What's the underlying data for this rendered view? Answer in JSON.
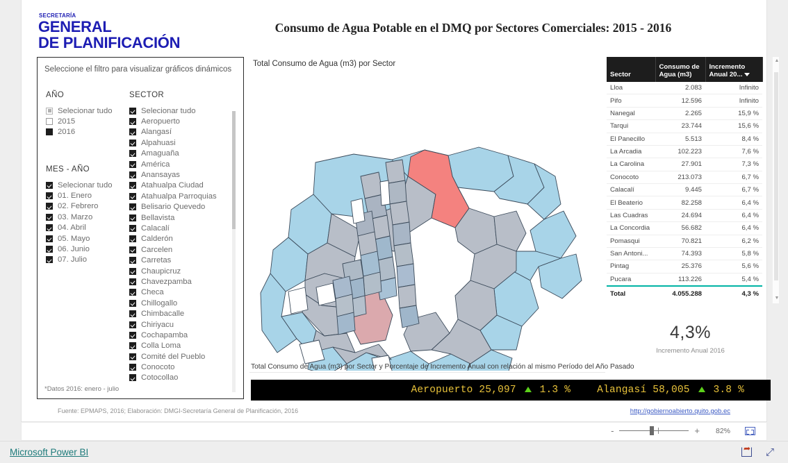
{
  "report": {
    "title": "Consumo de Agua Potable en el DMQ por Sectores Comerciales: 2015 - 2016",
    "logo": {
      "eyebrow": "SECRETARÍA",
      "line1": "GENERAL",
      "line2": "DE PLANIFICACIÓN",
      "color": "#1d1db3"
    }
  },
  "filter_panel": {
    "heading": "Seleccione el filtro para visualizar gráficos dinámicos",
    "note": "*Datos 2016: enero - julio",
    "ano": {
      "title": "AÑO",
      "items": [
        {
          "label": "Selecionar tudo",
          "state": "partial"
        },
        {
          "label": "2015",
          "state": "unchecked"
        },
        {
          "label": "2016",
          "state": "filled"
        }
      ]
    },
    "mes_ano": {
      "title": "MES - AÑO",
      "items": [
        {
          "label": "Selecionar tudo",
          "state": "checked"
        },
        {
          "label": "01. Enero",
          "state": "checked"
        },
        {
          "label": "02. Febrero",
          "state": "checked"
        },
        {
          "label": "03. Marzo",
          "state": "checked"
        },
        {
          "label": "04. Abril",
          "state": "checked"
        },
        {
          "label": "05. Mayo",
          "state": "checked"
        },
        {
          "label": "06. Junio",
          "state": "checked"
        },
        {
          "label": "07. Julio",
          "state": "checked"
        }
      ]
    },
    "sector": {
      "title": "SECTOR",
      "items": [
        {
          "label": "Selecionar tudo",
          "state": "checked"
        },
        {
          "label": "Aeropuerto",
          "state": "checked"
        },
        {
          "label": "Alangasí",
          "state": "checked"
        },
        {
          "label": "Alpahuasi",
          "state": "checked"
        },
        {
          "label": "Amaguaña",
          "state": "checked"
        },
        {
          "label": "América",
          "state": "checked"
        },
        {
          "label": "Anansayas",
          "state": "checked"
        },
        {
          "label": "Atahualpa Ciudad",
          "state": "checked"
        },
        {
          "label": "Atahualpa Parroquias",
          "state": "checked"
        },
        {
          "label": "Belisario Quevedo",
          "state": "checked"
        },
        {
          "label": "Bellavista",
          "state": "checked"
        },
        {
          "label": "Calacalí",
          "state": "checked"
        },
        {
          "label": "Calderón",
          "state": "checked"
        },
        {
          "label": "Carcelen",
          "state": "checked"
        },
        {
          "label": "Carretas",
          "state": "checked"
        },
        {
          "label": "Chaupicruz",
          "state": "checked"
        },
        {
          "label": "Chavezpamba",
          "state": "checked"
        },
        {
          "label": "Checa",
          "state": "checked"
        },
        {
          "label": "Chillogallo",
          "state": "checked"
        },
        {
          "label": "Chimbacalle",
          "state": "checked"
        },
        {
          "label": "Chiriyacu",
          "state": "checked"
        },
        {
          "label": "Cochapamba",
          "state": "checked"
        },
        {
          "label": "Colla Loma",
          "state": "checked"
        },
        {
          "label": "Comité del Pueblo",
          "state": "checked"
        },
        {
          "label": "Conocoto",
          "state": "checked"
        },
        {
          "label": "Cotocollao",
          "state": "checked"
        }
      ]
    }
  },
  "map_visual": {
    "title": "Total Consumo de Agua (m3) por Sector",
    "colors": {
      "low": "#a8d4e8",
      "mid": "#b8bec8",
      "high": "#f4827f",
      "pink": "#dba9ad",
      "outline": "#3b4a5a",
      "empty": "#ffffff"
    }
  },
  "table_visual": {
    "columns": [
      "Sector",
      "Consumo de Agua (m3)",
      "Incremento Anual 20..."
    ],
    "sorted_column": 2,
    "rows": [
      {
        "sector": "Lloa",
        "consumo": "2.083",
        "incremento": "Infinito"
      },
      {
        "sector": "Pifo",
        "consumo": "12.596",
        "incremento": "Infinito"
      },
      {
        "sector": "Nanegal",
        "consumo": "2.265",
        "incremento": "15,9 %"
      },
      {
        "sector": "Tarqui",
        "consumo": "23.744",
        "incremento": "15,6 %"
      },
      {
        "sector": "El Panecillo",
        "consumo": "5.513",
        "incremento": "8,4 %"
      },
      {
        "sector": "La Arcadia",
        "consumo": "102.223",
        "incremento": "7,6 %"
      },
      {
        "sector": "La Carolina",
        "consumo": "27.901",
        "incremento": "7,3 %"
      },
      {
        "sector": "Conocoto",
        "consumo": "213.073",
        "incremento": "6,7 %"
      },
      {
        "sector": "Calacalí",
        "consumo": "9.445",
        "incremento": "6,7 %"
      },
      {
        "sector": "El Beaterio",
        "consumo": "82.258",
        "incremento": "6,4 %"
      },
      {
        "sector": "Las Cuadras",
        "consumo": "24.694",
        "incremento": "6,4 %"
      },
      {
        "sector": "La Concordia",
        "consumo": "56.682",
        "incremento": "6,4 %"
      },
      {
        "sector": "Pomasqui",
        "consumo": "70.821",
        "incremento": "6,2 %"
      },
      {
        "sector": "San Antoni...",
        "consumo": "74.393",
        "incremento": "5,8 %"
      },
      {
        "sector": "Pintag",
        "consumo": "25.376",
        "incremento": "5,6 %"
      },
      {
        "sector": "Pucara",
        "consumo": "113.226",
        "incremento": "5,4 %"
      }
    ],
    "total": {
      "sector": "Total",
      "consumo": "4.055.288",
      "incremento": "4,3 %"
    },
    "accent": "#00b3a4"
  },
  "kpi": {
    "value": "4,3%",
    "label": "Incremento Anual 2016"
  },
  "ticker": {
    "caption": "Total Consumo de Agua (m3) por Sector y Porcentaje de Incremento Anual con relación al mismo Período del Año Pasado",
    "items": [
      {
        "sector": "Aeropuerto",
        "value": "25,097",
        "change": "1.3 %",
        "direction": "up"
      },
      {
        "sector": "Alangasí",
        "value": "58,005",
        "change": "3.8 %",
        "direction": "up"
      }
    ],
    "text_color": "#e8c23a",
    "up_color": "#5cd11a",
    "background": "#000000"
  },
  "footer": {
    "source": "Fuente: EPMAPS, 2016; Elaboración: DMGI-Secretaría General de Planificación, 2016",
    "link": "http://gobiernoabierto.quito.gob.ec"
  },
  "zoom_bar": {
    "minus": "-",
    "plus": "+",
    "percent": "82%",
    "fit_icon": "fit-to-page-icon"
  },
  "bottom_bar": {
    "brand": "Microsoft Power BI",
    "share_icon": "share-icon",
    "expand_icon": "fullscreen-icon"
  }
}
